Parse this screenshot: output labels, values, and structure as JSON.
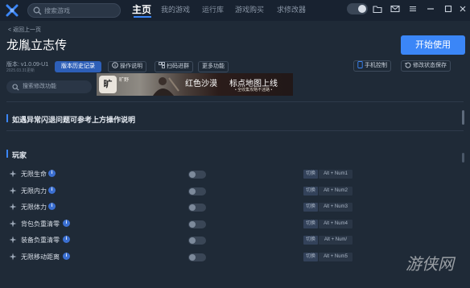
{
  "header": {
    "search_placeholder": "搜索游戏",
    "nav": [
      "主页",
      "我的游戏",
      "运行库",
      "游戏购买",
      "求修改器"
    ]
  },
  "game": {
    "back": "< 返回上一页",
    "title": "龙胤立志传",
    "version": "版本: v1.0.09-U1",
    "date": "2025.03.31更新",
    "history_btn": "版本历史记录",
    "guide_btn": "操作说明",
    "scan_btn": "扫码进群",
    "more_btn": "更多功能",
    "search_mod_placeholder": "搜索修改功能",
    "start_btn": "开始使用",
    "phone_btn": "手机控制",
    "save_btn": "修改状态保存"
  },
  "banner": {
    "brand": "旷",
    "brand_text": "旷野",
    "text1": "红色沙漠",
    "text2": "标点地图上线",
    "text3": "• 全收集攻略不迷路 •"
  },
  "notice": "如遇异常闪退问题可参考上方操作说明",
  "section": "玩家",
  "switch_label": "切换",
  "cheats": [
    {
      "name": "无限生命",
      "hotkey": "Alt + Num1",
      "enabled": false
    },
    {
      "name": "无限内力",
      "hotkey": "Alt + Num2",
      "enabled": false
    },
    {
      "name": "无限体力",
      "hotkey": "Alt + Num3",
      "enabled": false
    },
    {
      "name": "背包负重清零",
      "hotkey": "Alt + Num4",
      "enabled": false
    },
    {
      "name": "装备负重清零",
      "hotkey": "Alt + Num/",
      "enabled": false
    },
    {
      "name": "无限移动距离",
      "hotkey": "Alt + Num5",
      "enabled": false
    }
  ],
  "watermark": "游侠网",
  "colors": {
    "accent": "#3b86f7",
    "bg": "#1f2a37",
    "topbar": "#182230"
  }
}
